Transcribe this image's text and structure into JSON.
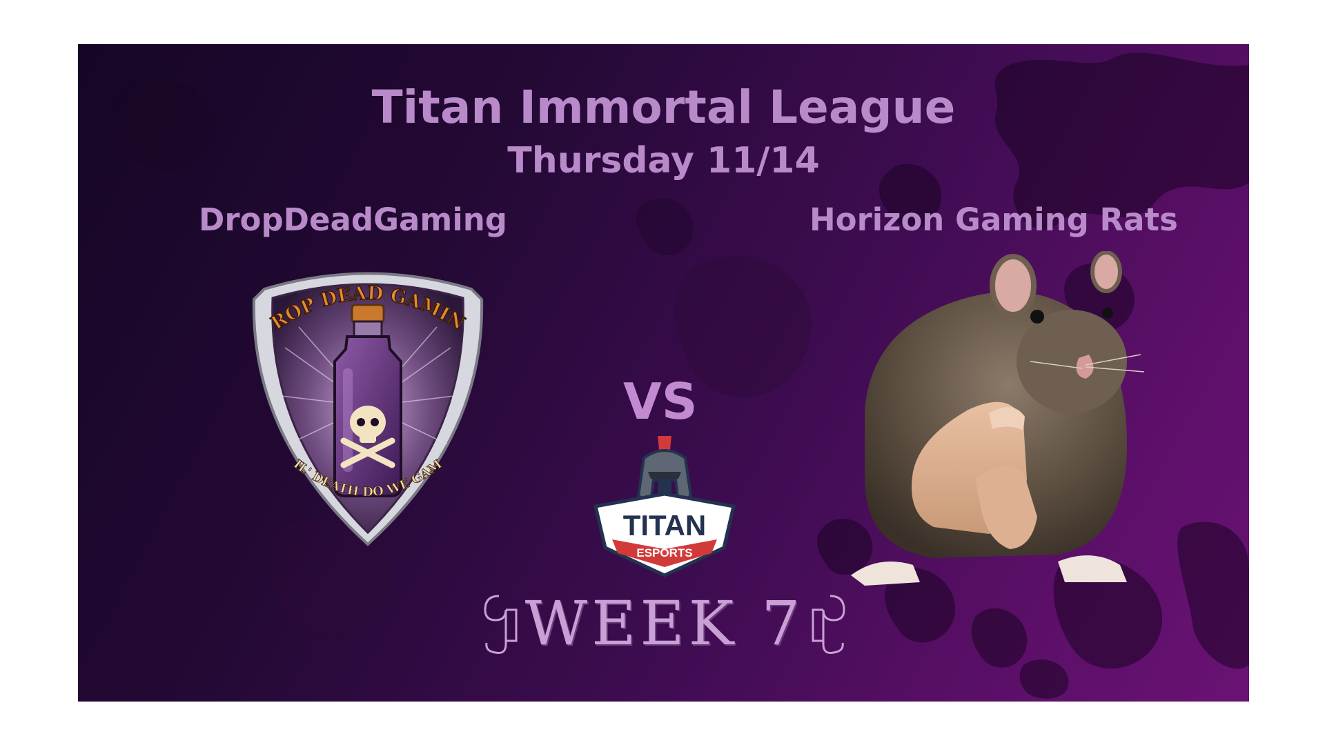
{
  "header": {
    "title": "Titan Immortal League",
    "date": "Thursday 11/14"
  },
  "matchup": {
    "home_team": "DropDeadGaming",
    "away_team": "Horizon Gaming Rats",
    "versus": "VS"
  },
  "home_logo": {
    "top_text": "DROP DEAD GAMING",
    "bottom_text": "TIL' DEATH DO WE GAME"
  },
  "league_logo": {
    "line1": "TITAN",
    "line2": "ESPORTS"
  },
  "week_banner": "WEEK 7",
  "colors": {
    "heading": "#b98ac9",
    "background_dark": "#160626",
    "background_light": "#6a1274",
    "shield_border": "#c0c0c8",
    "logo_text_orange": "#e58a2c",
    "titan_navy": "#23324f",
    "titan_red": "#d23a3a"
  },
  "icons": [
    "shield-crest-icon",
    "poison-bottle-icon",
    "skull-crossbones-icon",
    "spartan-helmet-icon",
    "rat-pointing-image"
  ]
}
